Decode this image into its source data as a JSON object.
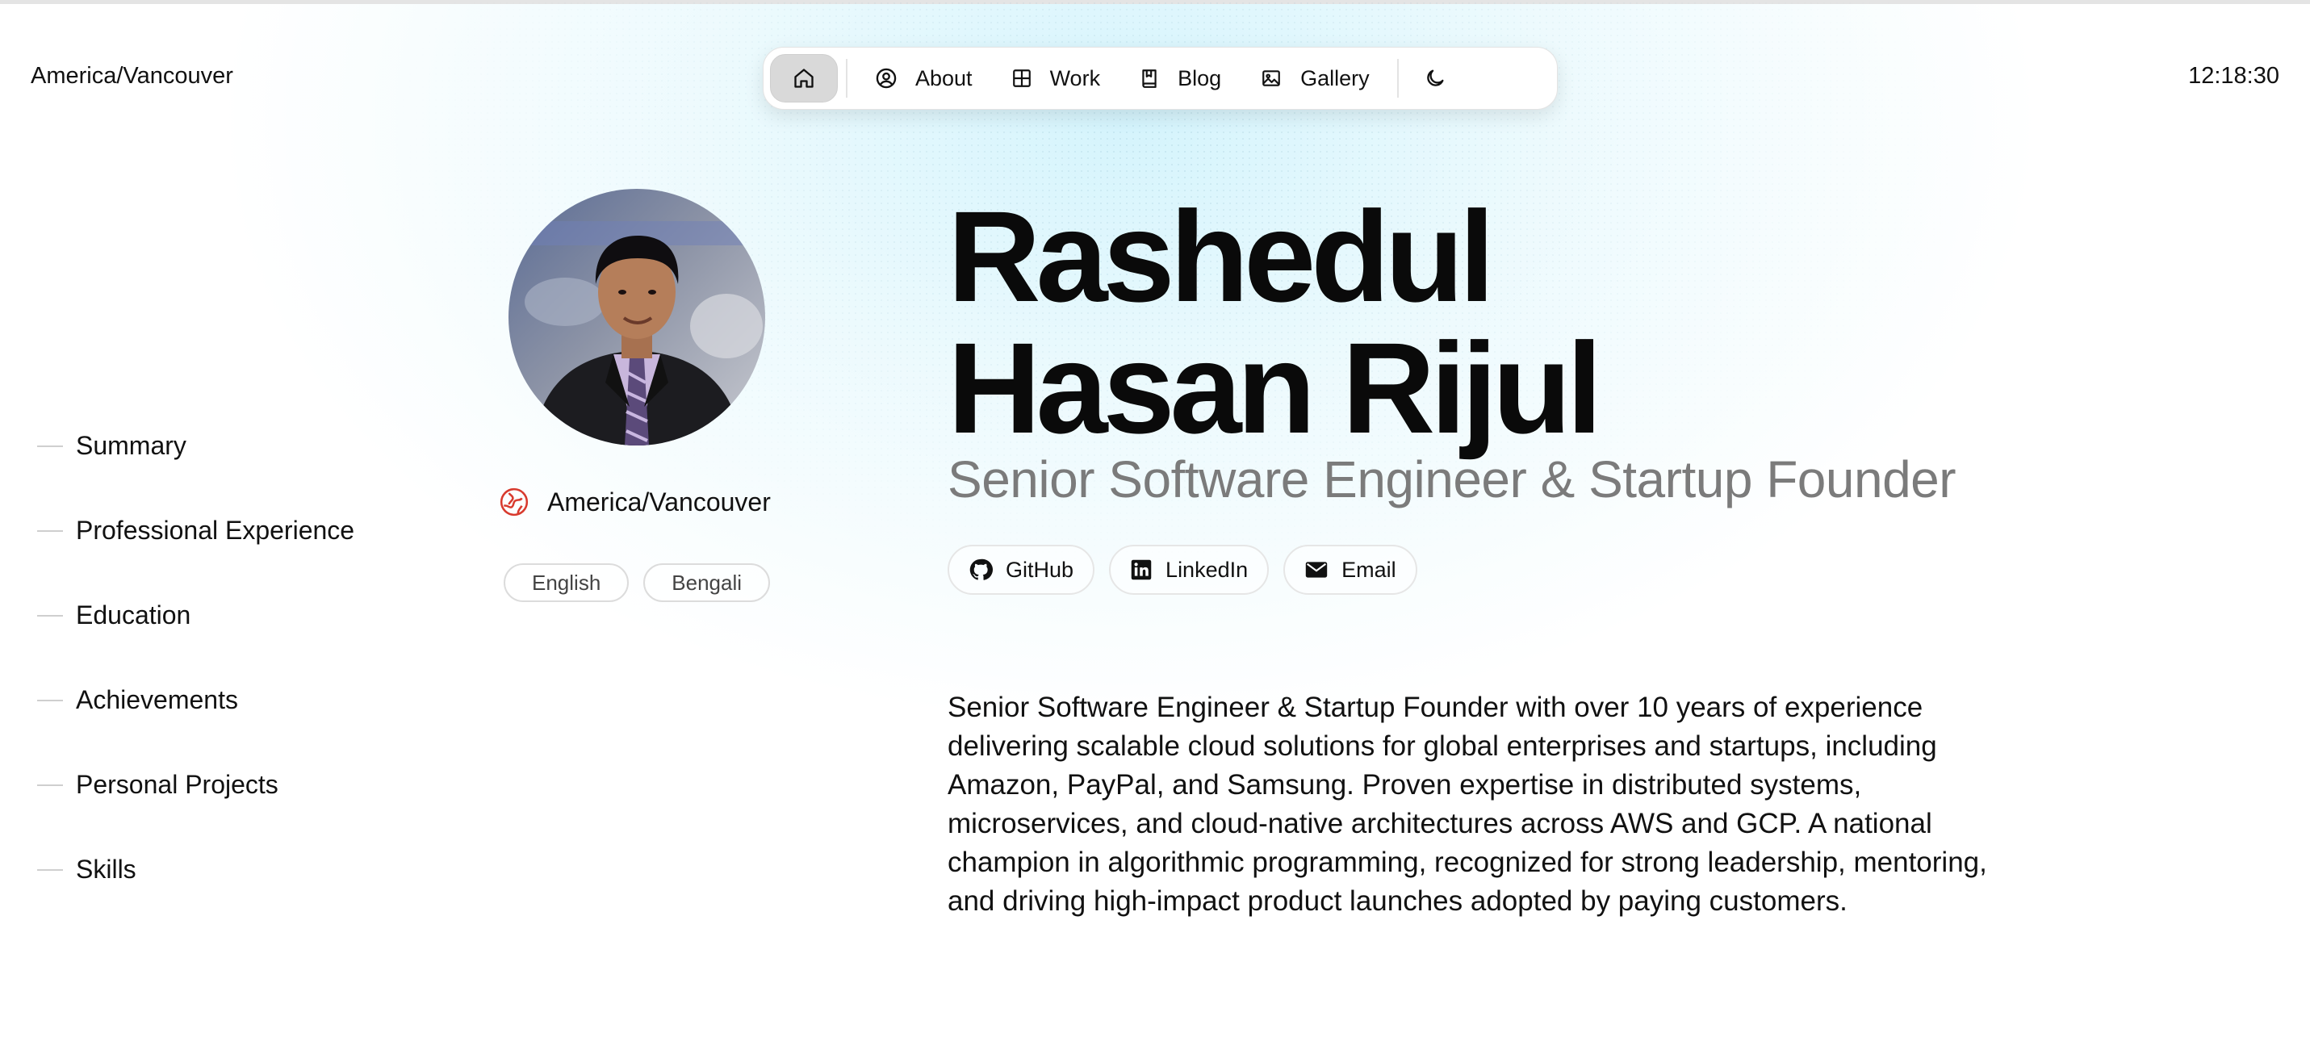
{
  "header": {
    "timezone": "America/Vancouver",
    "clock": "12:18:30"
  },
  "nav": {
    "items": [
      {
        "label": "About",
        "icon": "user-circle-icon"
      },
      {
        "label": "Work",
        "icon": "grid-icon"
      },
      {
        "label": "Blog",
        "icon": "book-icon"
      },
      {
        "label": "Gallery",
        "icon": "image-icon"
      }
    ],
    "home_icon": "home-icon",
    "theme_icon": "moon-icon"
  },
  "toc": {
    "items": [
      "Summary",
      "Professional Experience",
      "Education",
      "Achievements",
      "Personal Projects",
      "Skills"
    ]
  },
  "profile": {
    "location": "America/Vancouver",
    "languages": [
      "English",
      "Bengali"
    ],
    "name_line1": "Rashedul",
    "name_line2": "Hasan Rijul",
    "role": "Senior Software Engineer & Startup Founder",
    "links": [
      {
        "label": "GitHub",
        "icon": "github-icon"
      },
      {
        "label": "LinkedIn",
        "icon": "linkedin-icon"
      },
      {
        "label": "Email",
        "icon": "mail-icon"
      }
    ],
    "summary": "Senior Software Engineer & Startup Founder with over 10 years of experience delivering scalable cloud solutions for global enterprises and startups, including Amazon, PayPal, and Samsung. Proven expertise in distributed systems, microservices, and cloud-native architectures across AWS and GCP. A national champion in algorithmic programming, recognized for strong leadership, mentoring, and driving high-impact product launches adopted by paying customers."
  },
  "colors": {
    "location_icon": "#d83a2e",
    "accent_bg": "#dff5fb"
  }
}
